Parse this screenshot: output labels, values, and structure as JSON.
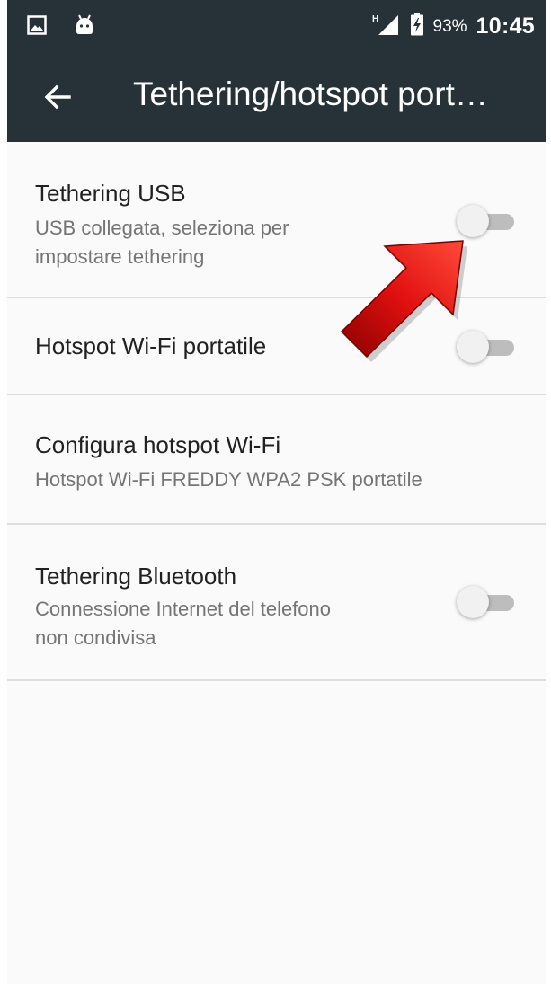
{
  "status_bar": {
    "battery_percent": "93%",
    "time": "10:45",
    "network_type": "H",
    "icons": [
      "image-icon",
      "android-icon",
      "signal-icon",
      "battery-charging-icon"
    ]
  },
  "toolbar": {
    "title": "Tethering/hotspot port…",
    "back_icon": "arrow-back-icon"
  },
  "items": [
    {
      "title": "Tethering USB",
      "subtitle": "USB collegata, seleziona per\nimpostare tethering",
      "toggle_on": false
    },
    {
      "title": "Hotspot Wi-Fi portatile",
      "toggle_on": false
    },
    {
      "title": "Configura hotspot Wi-Fi",
      "subtitle": "Hotspot Wi-Fi FREDDY WPA2 PSK portatile"
    },
    {
      "title": "Tethering Bluetooth",
      "subtitle": "Connessione Internet del telefono\nnon condivisa",
      "toggle_on": false
    }
  ],
  "colors": {
    "appbar": "#263238",
    "background": "#fafafa",
    "title_text": "#212121",
    "subtitle_text": "#757575",
    "toggle_track_off": "#bdbdbd",
    "toggle_thumb_off": "#f1f1f1",
    "annotation_arrow": "#d10a0a"
  }
}
